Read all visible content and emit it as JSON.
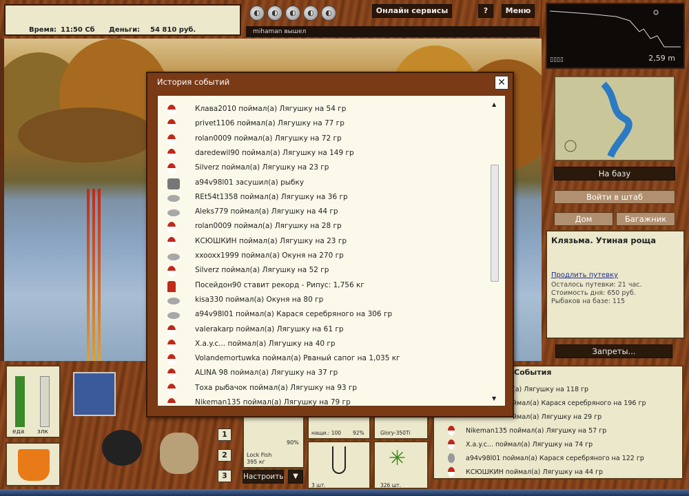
{
  "header": {
    "time_label": "Время:",
    "time_value": "11:50 Сб",
    "money_label": "Деньги:",
    "money_value": "54 810 руб.",
    "online_services": "Онлайн сервисы",
    "help": "?",
    "menu": "Меню",
    "status_message": "mihaman вышел"
  },
  "depth": {
    "value": "2,59 m"
  },
  "right_panel": {
    "to_base": "На базу",
    "enter_hq": "Войти в штаб",
    "home": "Дом",
    "trunk": "Багажник",
    "location_title": "Клязьма. Утиная роща",
    "extend_permit": "Продлить путевку",
    "permit_left": "Осталось путевки: 21 час.",
    "day_cost": "Стоимость дня: 650 руб.",
    "anglers": "Рыбаков на базе: 115",
    "bans": "Запреты..."
  },
  "dialog": {
    "title": "История событий",
    "close": "✕",
    "rows": [
      {
        "icon": "float",
        "text": "Клава2010 поймал(а) Лягушку на 54 гр"
      },
      {
        "icon": "float",
        "text": "privet1106 поймал(а) Лягушку на 77 гр"
      },
      {
        "icon": "float",
        "text": "rolan0009 поймал(а) Лягушку на 72 гр"
      },
      {
        "icon": "float",
        "text": "daredewil90 поймал(а) Лягушку на 149 гр"
      },
      {
        "icon": "float",
        "text": "Silverz поймал(а) Лягушку на 23 гр"
      },
      {
        "icon": "pot",
        "text": "a94v98l01 засушил(а) рыбку"
      },
      {
        "icon": "spoon",
        "text": "REt54t1358 поймал(а) Лягушку на 36 гр"
      },
      {
        "icon": "spoon",
        "text": "Aleks779 поймал(а) Лягушку на 44 гр"
      },
      {
        "icon": "float",
        "text": "rolan0009 поймал(а) Лягушку на 28 гр"
      },
      {
        "icon": "float",
        "text": "КСЮШКИН поймал(а) Лягушку на 23 гр"
      },
      {
        "icon": "spoon",
        "text": "xxooxx1999 поймал(а) Окуня на 270 гр"
      },
      {
        "icon": "float",
        "text": "Silverz поймал(а) Лягушку на 52 гр"
      },
      {
        "icon": "record",
        "text": "Посейдон90 ставит рекорд - Рипус: 1,756 кг"
      },
      {
        "icon": "spoon",
        "text": "kisa330 поймал(а) Окуня на 80 гр"
      },
      {
        "icon": "spoon",
        "text": "a94v98l01 поймал(а) Карася серебряного на 306 гр"
      },
      {
        "icon": "float",
        "text": "valerakarp поймал(а) Лягушку на 61 гр"
      },
      {
        "icon": "float",
        "text": "X.a.y.c... поймал(а) Лягушку на 40 гр"
      },
      {
        "icon": "float",
        "text": "Volandemortuwka поймал(а) Рваный сапог на 1,035 кг"
      },
      {
        "icon": "float",
        "text": "ALINA 98 поймал(а) Лягушку на 37 гр"
      },
      {
        "icon": "float",
        "text": "Тоха рыбачок поймал(а) Лягушку на 93 гр"
      },
      {
        "icon": "float",
        "text": "Nikeman135 поймал(а) Лягушку на 79 гр"
      }
    ]
  },
  "events_panel": {
    "title": "События",
    "rows": [
      {
        "icon": "none",
        "text": "(а) Лягушку на 118 гр"
      },
      {
        "icon": "none",
        "text": "ймал(а) Карася серебряного на 196 гр"
      },
      {
        "icon": "none",
        "text": "ймал(а) Лягушку на 29 гр"
      },
      {
        "icon": "float",
        "text": "Nikeman135 поймал(а) Лягушку на 57 гр"
      },
      {
        "icon": "float",
        "text": "X.a.y.c... поймал(а) Лягушку на 74 гр"
      },
      {
        "icon": "spoon",
        "text": "a94v98l01 поймал(а) Карася серебряного на 122 гр"
      },
      {
        "icon": "float",
        "text": "КСЮШКИН поймал(а) Лягушку на 44 гр"
      }
    ]
  },
  "bottom": {
    "meter_left": "еда",
    "meter_right": "злк",
    "slot_1": "1",
    "slot_2": "2",
    "slot_3": "3",
    "rod_name": "Lock Fish",
    "rod_weight": "395 кг",
    "rod_percent": "90%",
    "line_label": "нащи.: 100",
    "line_percent": "92%",
    "reel_label": "Glory-350Ti",
    "hooks_count": "3 шт.",
    "bait_count": "326 шт.",
    "configure": "Настроить",
    "dropdown": "▼"
  }
}
